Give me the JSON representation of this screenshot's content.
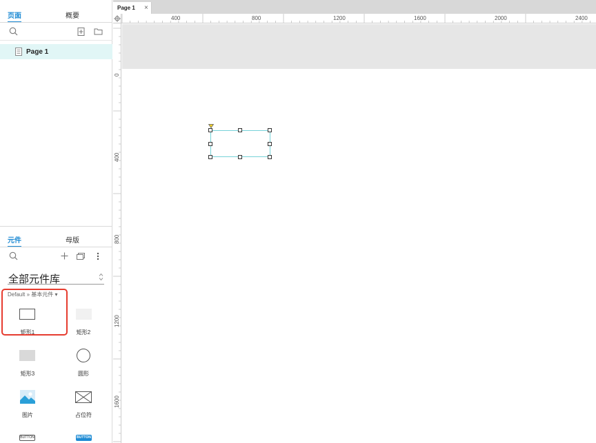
{
  "left_panel": {
    "top_tabs": [
      {
        "label": "页面",
        "active": true
      },
      {
        "label": "概要",
        "active": false
      }
    ],
    "pages": [
      {
        "label": "Page 1",
        "selected": true
      }
    ],
    "bottom_tabs": [
      {
        "label": "元件",
        "active": true
      },
      {
        "label": "母版",
        "active": false
      }
    ],
    "library": {
      "name": "全部元件库",
      "breadcrumb": "Default » 基本元件 ▾"
    },
    "widgets": [
      {
        "label": "矩形1"
      },
      {
        "label": "矩形2"
      },
      {
        "label": "矩形3"
      },
      {
        "label": "圆形"
      },
      {
        "label": "图片"
      },
      {
        "label": "占位符"
      },
      {
        "label": "BUTTON"
      },
      {
        "label": "BUTTON"
      }
    ]
  },
  "document": {
    "tab_label": "Page 1",
    "close_glyph": "×"
  },
  "rulers": {
    "horizontal": [
      "400",
      "800",
      "1200",
      "1600",
      "2000",
      "2400"
    ],
    "vertical": [
      "0",
      "400",
      "800",
      "1200",
      "1600"
    ]
  },
  "colors": {
    "accent": "#1e8bd4",
    "selection": "#76d2d8",
    "highlight": "#e63b2e",
    "page_row": "#e1f6f6"
  }
}
